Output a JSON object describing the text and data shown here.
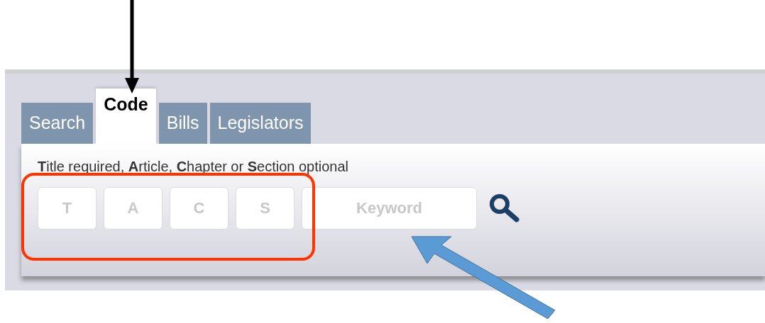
{
  "tabs": [
    {
      "label": "Search",
      "selected": false
    },
    {
      "label": "Code",
      "selected": true
    },
    {
      "label": "Bills",
      "selected": false
    },
    {
      "label": "Legislators",
      "selected": false
    }
  ],
  "instruction": "**T**itle required, **A**rticle, **C**hapter or **S**ection optional",
  "fields": [
    {
      "placeholder": "T",
      "kind": "short"
    },
    {
      "placeholder": "A",
      "kind": "short"
    },
    {
      "placeholder": "C",
      "kind": "short"
    },
    {
      "placeholder": "S",
      "kind": "short"
    },
    {
      "placeholder": "Keyword",
      "kind": "wide"
    }
  ]
}
